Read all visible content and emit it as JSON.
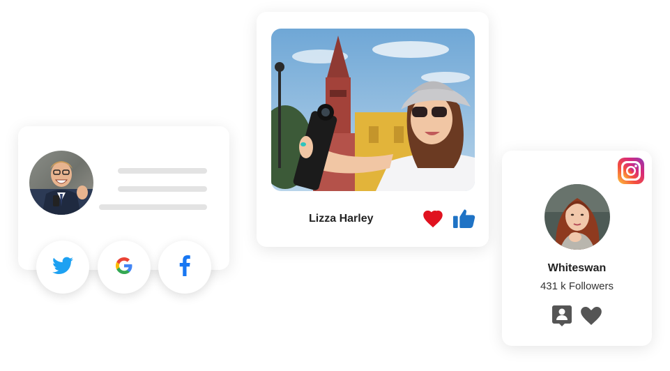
{
  "photo_card": {
    "name": "Lizza Harley",
    "icons": [
      "heart-icon",
      "thumbs-up-icon"
    ]
  },
  "profile_card_left": {
    "social_buttons": [
      "twitter-icon",
      "google-icon",
      "facebook-icon"
    ]
  },
  "profile_card_right": {
    "name": "Whiteswan",
    "followers": "431 k Followers",
    "icons": [
      "instagram-icon",
      "contact-icon",
      "heart-icon"
    ]
  },
  "colors": {
    "heart_red": "#e0121f",
    "thumb_blue": "#1f73c5",
    "twitter_blue": "#1da1f2",
    "facebook_blue": "#1877f2",
    "icon_gray": "#555555",
    "skeleton_gray": "#e3e3e3"
  }
}
